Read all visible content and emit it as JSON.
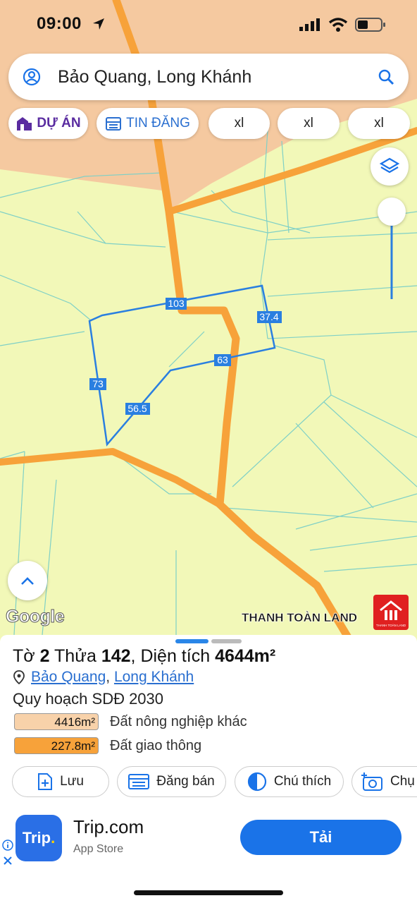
{
  "status": {
    "time": "09:00"
  },
  "search": {
    "text": "Bảo Quang, Long Khánh"
  },
  "chips": [
    {
      "label": "DỰ ÁN"
    },
    {
      "label": "TIN ĐĂNG"
    },
    {
      "label": "xl"
    },
    {
      "label": "xl"
    },
    {
      "label": "xl"
    }
  ],
  "map": {
    "dimensions": [
      "103",
      "37.4",
      "63",
      "56.5",
      "73"
    ],
    "attribution": "Google",
    "brand": "THANH TOÀN LAND",
    "brand_logo_text": "THANH TOÀN LAND",
    "colors": {
      "urban": "#f5c9a0",
      "agri": "#f2f8b8",
      "road": "#f7a23a",
      "parcel": "#2a7fe0"
    }
  },
  "parcel": {
    "to_label": "Tờ",
    "to": "2",
    "thua_label": "Thửa",
    "thua": "142",
    "area_label": "Diện tích",
    "area": "4644m²",
    "ward": "Bảo Quang",
    "city": "Long Khánh",
    "plan_title": "Quy hoạch SDĐ 2030",
    "landuse": [
      {
        "area": "4416m²",
        "label": "Đất nông nghiệp khác",
        "color": "#f8d2aa"
      },
      {
        "area": "227.8m²",
        "label": "Đất giao thông",
        "color": "#f7a23a"
      }
    ]
  },
  "actions": [
    {
      "label": "Lưu"
    },
    {
      "label": "Đăng bán"
    },
    {
      "label": "Chú thích"
    },
    {
      "label": "Chụ"
    }
  ],
  "ad": {
    "logo": "Trip",
    "logo_dot": ".",
    "title": "Trip.com",
    "subtitle": "App Store",
    "button": "Tải"
  }
}
